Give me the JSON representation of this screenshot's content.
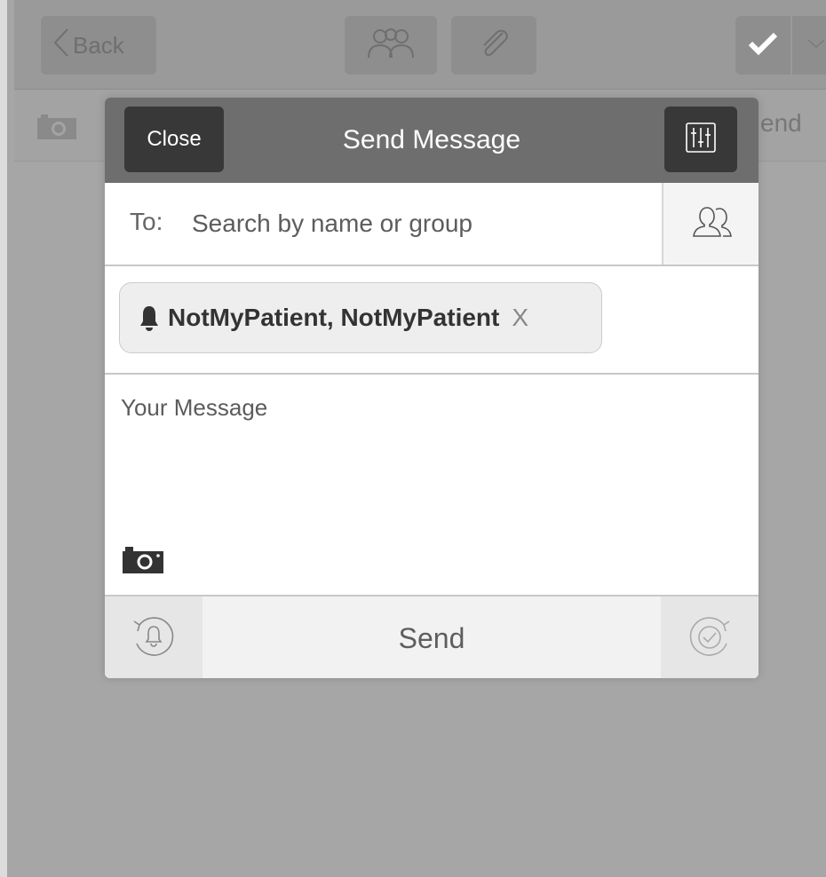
{
  "background_app": {
    "toolbar": {
      "back_label": "Back",
      "icons": [
        "group-icon",
        "paperclip-icon",
        "checkmark-icon",
        "chevron-down-icon"
      ]
    },
    "row2": {
      "send_partial": "end",
      "icons": [
        "camera-icon"
      ]
    }
  },
  "modal": {
    "title": "Send Message",
    "close_label": "Close",
    "filter_icon": "sliders-icon",
    "to": {
      "label": "To:",
      "placeholder": "Search by name or group",
      "value": "",
      "contacts_icon": "contacts-icon"
    },
    "recipients": [
      {
        "icon": "bell-icon",
        "name": "NotMyPatient, NotMyPatient",
        "remove_label": "X"
      }
    ],
    "message": {
      "placeholder": "Your Message",
      "value": "",
      "camera_icon": "camera-icon"
    },
    "footer": {
      "send_label": "Send",
      "reminder_icon": "reminder-bell-icon",
      "read_receipt_icon": "read-receipt-icon"
    }
  },
  "colors": {
    "header_bg": "#6e6e6e",
    "button_dark": "#383838",
    "overlay_bg": "#a6a6a6",
    "chip_bg": "#eeeeee"
  }
}
